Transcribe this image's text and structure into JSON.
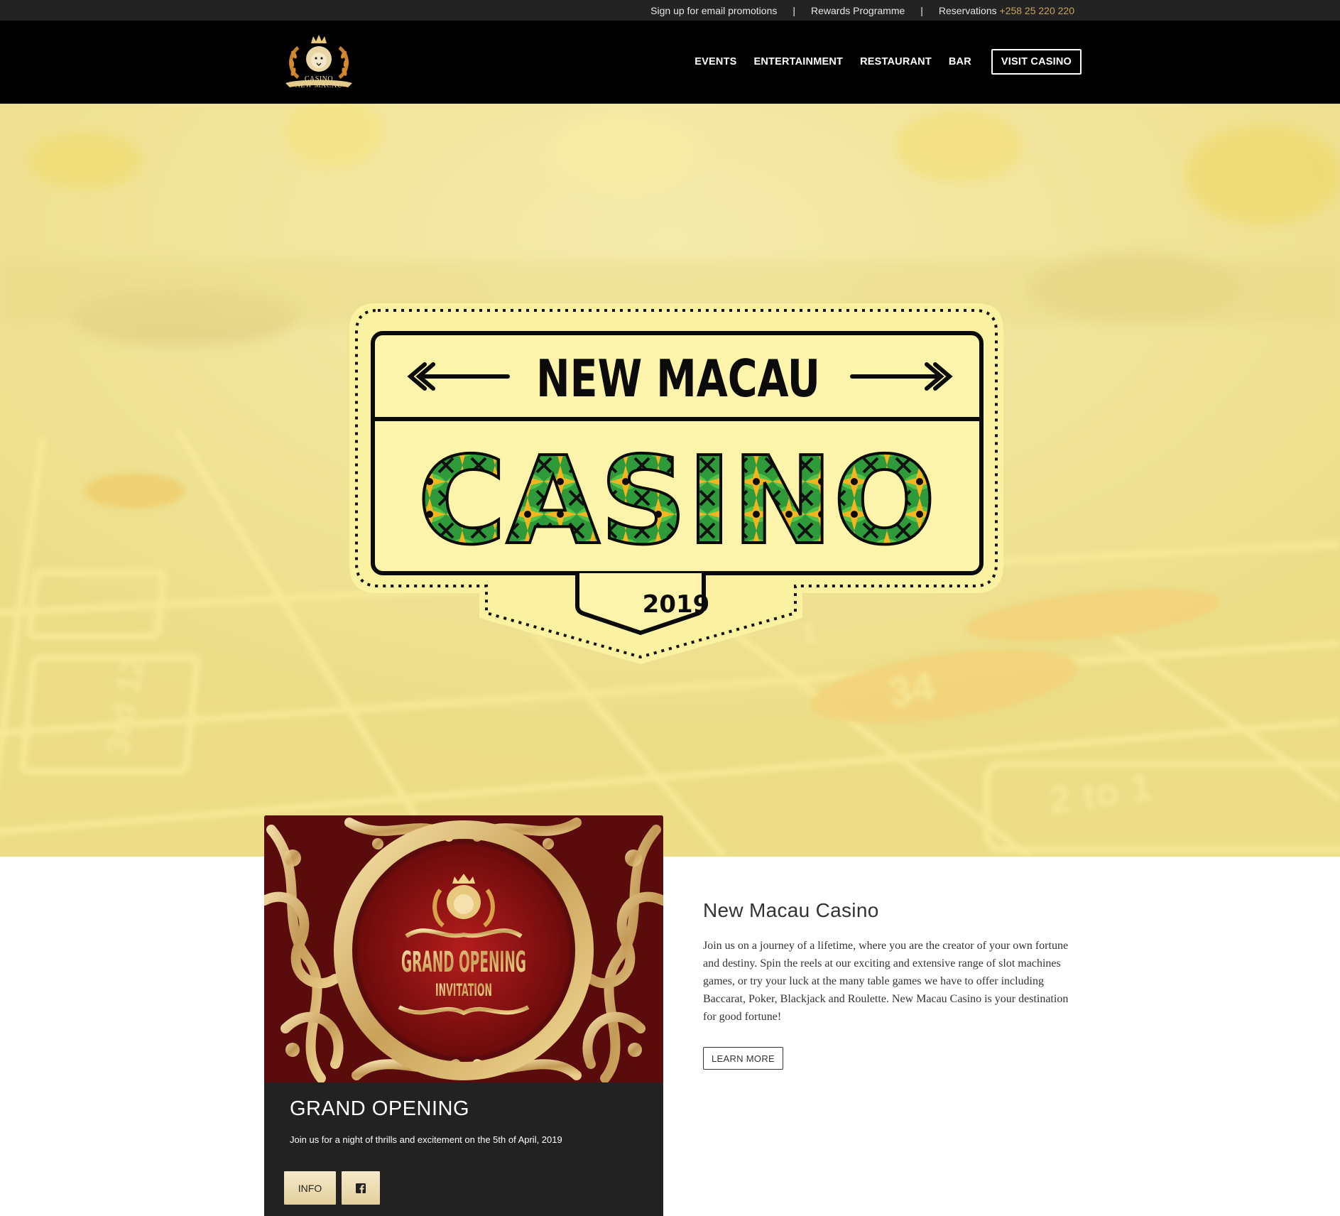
{
  "topbar": {
    "email_link": "Sign up for email promotions",
    "separator": "|",
    "rewards_link": "Rewards Programme",
    "reservations_label": "Reservations",
    "reservations_phone": "+258 25 220 220"
  },
  "header": {
    "logo_line1": "CASINO",
    "logo_line2": "NEW MACAU",
    "nav": {
      "events": "EVENTS",
      "entertainment": "ENTERTAINMENT",
      "restaurant": "RESTAURANT",
      "bar": "BAR",
      "visit": "VISIT CASINO"
    }
  },
  "hero": {
    "sign_top": "NEW MACAU",
    "sign_main": "CASINO",
    "sign_year": "2019",
    "table_numbers": [
      "34",
      "1",
      "2 to 1",
      "3rd 12"
    ]
  },
  "event_card": {
    "image_title": "GRAND OPENING",
    "image_subtitle": "INVITATION",
    "title": "GRAND OPENING",
    "description": "Join us for a night of thrills and excitement on the 5th of April, 2019",
    "info_button": "INFO",
    "facebook_icon": "facebook-icon"
  },
  "about": {
    "title": "New Macau Casino",
    "body": "Join us on a journey of a lifetime, where you are the creator of your own fortune and destiny. Spin the reels at our exciting and extensive range of slot machines games, or try your luck at the many table games we have to offer including Baccarat, Poker, Blackjack and Roulette. New Macau Casino is your destination for good fortune!",
    "learn_more": "LEARN MORE"
  },
  "colors": {
    "topbar_bg": "#232323",
    "header_bg": "#000000",
    "accent_gold": "#c7a25b",
    "card_bg": "#222222",
    "hero_tint": "#f3e692"
  }
}
